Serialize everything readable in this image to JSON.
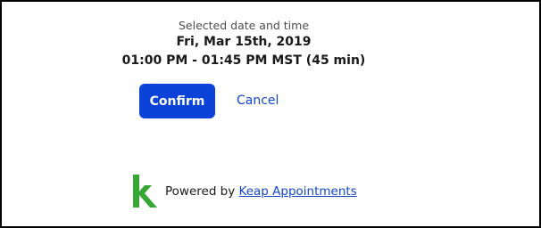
{
  "selection": {
    "caption": "Selected date and time",
    "date": "Fri, Mar 15th, 2019",
    "time_range": "01:00 PM - 01:45 PM MST (45 min)"
  },
  "actions": {
    "confirm_label": "Confirm",
    "cancel_label": "Cancel"
  },
  "footer": {
    "powered_by": "Powered by",
    "link_text": "Keap Appointments",
    "logo_icon": "keap-k-logo-icon"
  },
  "colors": {
    "accent": "#0b43d8",
    "link": "#1646c4",
    "logo": "#36a635"
  }
}
